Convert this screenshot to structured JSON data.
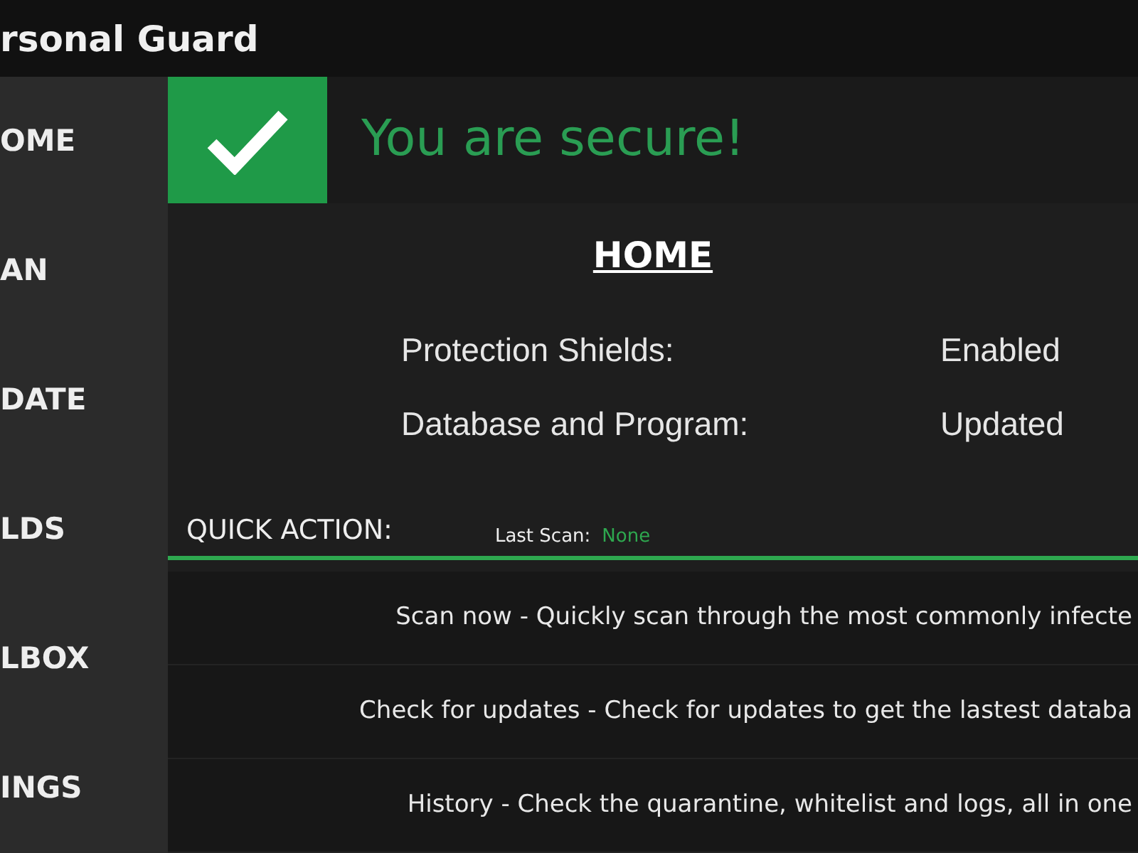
{
  "window": {
    "title": "rsonal Guard"
  },
  "sidebar": {
    "items": [
      {
        "label": "OME"
      },
      {
        "label": "AN"
      },
      {
        "label": "DATE"
      },
      {
        "label": "LDS"
      },
      {
        "label": "LBOX"
      },
      {
        "label": "INGS"
      }
    ]
  },
  "status_banner": {
    "secure": true,
    "message": "You are secure!"
  },
  "home": {
    "heading": "HOME",
    "rows": [
      {
        "label": "Protection Shields:",
        "value": "Enabled"
      },
      {
        "label": "Database and Program:",
        "value": "Updated"
      }
    ]
  },
  "quick_action": {
    "title": "QUICK ACTION:",
    "last_scan_label": "Last Scan:",
    "last_scan_value": "None",
    "actions": [
      "Scan now - Quickly scan through the most commonly infecte",
      "Check for updates - Check for updates to get the lastest databa",
      "History - Check the quarantine, whitelist and logs, all in one"
    ]
  }
}
